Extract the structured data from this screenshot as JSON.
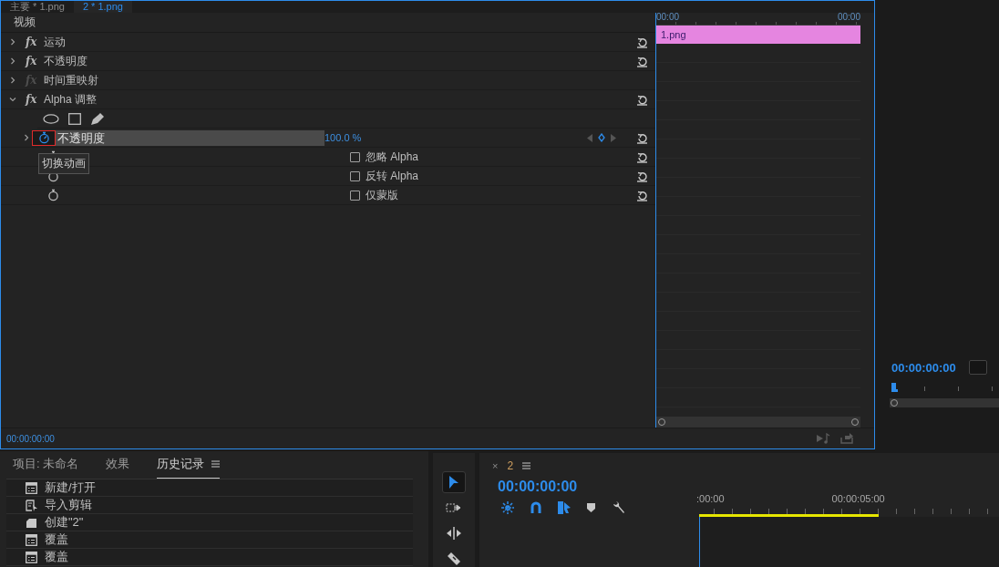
{
  "source_tabs": [
    {
      "label": "主要 * 1.png",
      "selected": false
    },
    {
      "label": "2 * 1.png",
      "selected": true
    }
  ],
  "section": "视频",
  "effects": [
    {
      "badge": "fx",
      "name": "运动",
      "expanded": false,
      "enabled": true,
      "resettable": true
    },
    {
      "badge": "fx",
      "name": "不透明度",
      "expanded": false,
      "enabled": true,
      "resettable": true
    },
    {
      "badge": "fx",
      "name": "时间重映射",
      "expanded": false,
      "enabled": false,
      "resettable": false
    },
    {
      "badge": "fx",
      "name": "Alpha 调整",
      "expanded": true,
      "enabled": true,
      "resettable": true,
      "properties": [
        {
          "kind": "value",
          "name": "不透明度",
          "value": "100.0 %",
          "animated": true,
          "highlighted": true
        },
        {
          "kind": "checkbox",
          "label": "忽略 Alpha",
          "checked": false
        },
        {
          "kind": "checkbox",
          "label": "反转 Alpha",
          "checked": false
        },
        {
          "kind": "checkbox",
          "label": "仅蒙版",
          "checked": false
        }
      ]
    }
  ],
  "tooltip": "切换动画",
  "clip_label": "1.png",
  "mini_ruler": [
    "00:00",
    "00:00"
  ],
  "footer_timecode": "00:00:00:00",
  "program_timecode": "00:00:00:00",
  "bottom_tabs": [
    {
      "label": "项目: 未命名",
      "selected": false
    },
    {
      "label": "效果",
      "selected": false
    },
    {
      "label": "历史记录",
      "selected": true
    }
  ],
  "history": [
    {
      "kind": "list",
      "label": "新建/打开"
    },
    {
      "kind": "import",
      "label": "导入剪辑"
    },
    {
      "kind": "sequence",
      "label": "创建\"2\""
    },
    {
      "kind": "list",
      "label": "覆盖"
    },
    {
      "kind": "list",
      "label": "覆盖"
    }
  ],
  "tools": [
    {
      "kind": "selection",
      "selected": true
    },
    {
      "kind": "track-select",
      "selected": false
    },
    {
      "kind": "ripple",
      "selected": false
    },
    {
      "kind": "razor",
      "selected": false
    }
  ],
  "timeline": {
    "close": "×",
    "tab": "2",
    "timecode": "00:00:00:00",
    "ruler": [
      ":00:00",
      "00:00:05:00"
    ]
  }
}
